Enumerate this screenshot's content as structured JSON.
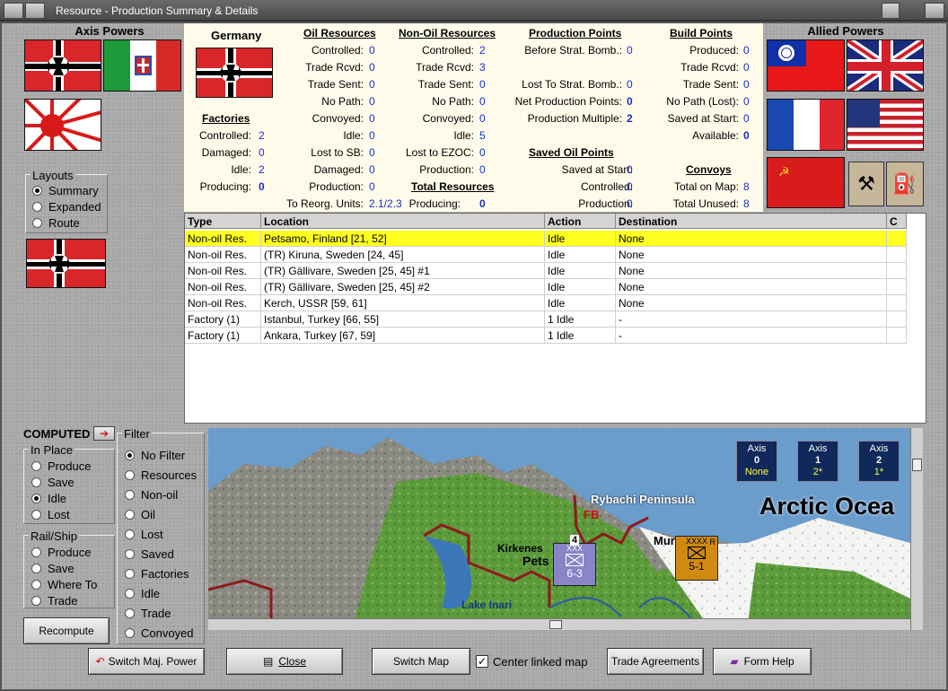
{
  "window": {
    "title": "Resource - Production Summary & Details"
  },
  "axis_powers": {
    "title": "Axis Powers",
    "flags": [
      "germany-flag",
      "italy-flag",
      "japan-flag"
    ]
  },
  "allied_powers": {
    "title": "Allied Powers",
    "flags": [
      "china-flag",
      "uk-flag",
      "france-flag",
      "usa-flag",
      "ussr-flag"
    ]
  },
  "layouts": {
    "title": "Layouts",
    "options": [
      "Summary",
      "Expanded",
      "Route"
    ],
    "selected": 0
  },
  "country": {
    "name": "Germany"
  },
  "factories": {
    "title": "Factories",
    "rows": [
      {
        "label": "Controlled:",
        "value": "2"
      },
      {
        "label": "Damaged:",
        "value": "0"
      },
      {
        "label": "Idle:",
        "value": "2"
      },
      {
        "label": "Producing:",
        "value": "0"
      }
    ]
  },
  "oil": {
    "title": "Oil Resources",
    "rows": [
      {
        "label": "Controlled:",
        "value": "0"
      },
      {
        "label": "Trade Rcvd:",
        "value": "0"
      },
      {
        "label": "Trade Sent:",
        "value": "0"
      },
      {
        "label": "No Path:",
        "value": "0"
      },
      {
        "label": "Convoyed:",
        "value": "0"
      },
      {
        "label": "Idle:",
        "value": "0"
      },
      {
        "label": "Lost to SB:",
        "value": "0"
      },
      {
        "label": "Damaged:",
        "value": "0"
      },
      {
        "label": "Production:",
        "value": "0"
      },
      {
        "label": "To Reorg. Units:",
        "value": "2.1/2.3"
      }
    ]
  },
  "nonoil": {
    "title": "Non-Oil Resources",
    "rows": [
      {
        "label": "Controlled:",
        "value": "2"
      },
      {
        "label": "Trade Rcvd:",
        "value": "3"
      },
      {
        "label": "Trade Sent:",
        "value": "0"
      },
      {
        "label": "No Path:",
        "value": "0"
      },
      {
        "label": "Convoyed:",
        "value": "0"
      },
      {
        "label": "Idle:",
        "value": "5"
      },
      {
        "label": "Lost to EZOC:",
        "value": "0"
      },
      {
        "label": "Production:",
        "value": "0"
      }
    ]
  },
  "total": {
    "title": "Total Resources",
    "label": "Producing:",
    "value": "0"
  },
  "pp": {
    "title": "Production Points",
    "rows": [
      {
        "label": "Before Strat. Bomb.:",
        "value": "0"
      },
      {
        "label": "Lost To Strat. Bomb.:",
        "value": "0"
      },
      {
        "label": "Net Production Points:",
        "value": "0"
      },
      {
        "label": "Production Multiple:",
        "value": "2"
      }
    ]
  },
  "saved_oil": {
    "title": "Saved Oil Points",
    "rows": [
      {
        "label": "Saved at Start:",
        "value": "0"
      },
      {
        "label": "Controlled:",
        "value": "0"
      },
      {
        "label": "Production:",
        "value": "0"
      }
    ]
  },
  "bp": {
    "title": "Build Points",
    "rows": [
      {
        "label": "Produced:",
        "value": "0"
      },
      {
        "label": "Trade Rcvd:",
        "value": "0"
      },
      {
        "label": "Trade Sent:",
        "value": "0"
      },
      {
        "label": "No Path (Lost):",
        "value": "0"
      },
      {
        "label": "Saved at Start:",
        "value": "0"
      },
      {
        "label": "Available:",
        "value": "0"
      }
    ]
  },
  "convoys": {
    "title": "Convoys",
    "rows": [
      {
        "label": "Total on Map:",
        "value": "8"
      },
      {
        "label": "Total Unused:",
        "value": "8"
      }
    ]
  },
  "table": {
    "headers": [
      "Type",
      "Location",
      "Action",
      "Destination",
      "C"
    ],
    "rows": [
      [
        "Non-oil Res.",
        "Petsamo, Finland [21, 52]",
        "Idle",
        "None"
      ],
      [
        "Non-oil Res.",
        "(TR) Kiruna, Sweden [24, 45]",
        "Idle",
        "None"
      ],
      [
        "Non-oil Res.",
        "(TR) Gällivare, Sweden [25, 45] #1",
        "Idle",
        "None"
      ],
      [
        "Non-oil Res.",
        "(TR) Gällivare, Sweden [25, 45] #2",
        "Idle",
        "None"
      ],
      [
        "Non-oil Res.",
        "Kerch, USSR [59, 61]",
        "Idle",
        "None"
      ],
      [
        "Factory (1)",
        "Istanbul, Turkey [66, 55]",
        "1 Idle",
        "-"
      ],
      [
        "Factory (1)",
        "Ankara, Turkey [67, 59]",
        "1 Idle",
        "-"
      ]
    ]
  },
  "computed": {
    "label": "COMPUTED"
  },
  "in_place": {
    "title": "In Place",
    "options": [
      "Produce",
      "Save",
      "Idle",
      "Lost"
    ],
    "selected": 2
  },
  "rail_ship": {
    "title": "Rail/Ship",
    "options": [
      "Produce",
      "Save",
      "Where To",
      "Trade"
    ]
  },
  "filter": {
    "title": "Filter",
    "options": [
      "No Filter",
      "Resources",
      "Non-oil",
      "Oil",
      "Lost",
      "Saved",
      "Factories",
      "Idle",
      "Trade",
      "Convoyed"
    ],
    "selected": 0
  },
  "recompute": "Recompute",
  "map": {
    "labels": {
      "rybachi": "Rybachi Peninsula",
      "fb": "FB",
      "arctic": "Arctic Ocea",
      "kirkenes": "Kirkenes",
      "pets": "Pets",
      "murmansk": "Murmansk",
      "inari": "Lake Inari"
    },
    "units": [
      {
        "top": "4",
        "size": "XXX",
        "strength": "6-3"
      },
      {
        "size": "XXXX",
        "strength": "5-1",
        "corner": "R"
      }
    ],
    "axis_boxes": [
      {
        "label": "Axis",
        "value": "0",
        "sub": "None",
        "color": "#ffff40"
      },
      {
        "label": "Axis",
        "value": "1",
        "sub": "2*",
        "color": "#ffff40"
      },
      {
        "label": "Axis",
        "value": "2",
        "sub": "1*",
        "color": "#ffff40"
      }
    ]
  },
  "buttons": {
    "switch_power": "Switch Maj. Power",
    "close": "Close",
    "switch_map": "Switch Map",
    "center_linked": "Center linked map",
    "trade": "Trade Agreements",
    "help": "Form Help"
  }
}
